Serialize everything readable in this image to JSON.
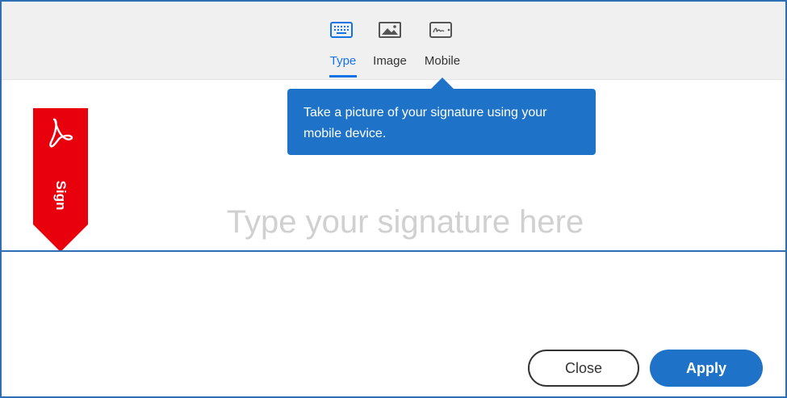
{
  "tabs": [
    {
      "id": "type",
      "label": "Type",
      "icon": "keyboard-icon",
      "active": true
    },
    {
      "id": "image",
      "label": "Image",
      "icon": "image-icon",
      "active": false
    },
    {
      "id": "mobile",
      "label": "Mobile",
      "icon": "mobile-device-icon",
      "active": false
    }
  ],
  "tooltip": {
    "text": "Take a picture of your signature using your mobile device."
  },
  "sign_ribbon": {
    "label": "Sign",
    "icon": "acrobat-logo-icon"
  },
  "signature": {
    "value": "",
    "placeholder": "Type your signature here"
  },
  "buttons": {
    "close_label": "Close",
    "apply_label": "Apply"
  },
  "colors": {
    "accent": "#1473e6",
    "tooltip_bg": "#1e73c8",
    "ribbon_red": "#e8000d",
    "border_blue": "#2f6eb5"
  }
}
